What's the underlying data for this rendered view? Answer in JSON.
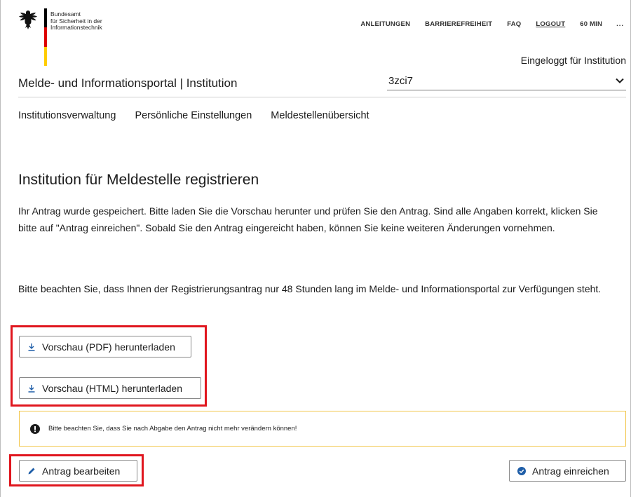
{
  "header": {
    "logo": {
      "line1": "Bundesamt",
      "line2": "für Sicherheit in der",
      "line3": "Informationstechnik",
      "icon": "federal-eagle-icon"
    },
    "topnav": {
      "instructions": "ANLEITUNGEN",
      "accessibility": "BARRIEREFREIHEIT",
      "faq": "FAQ",
      "logout": "LOGOUT",
      "timer": "60 MIN",
      "more": "..."
    },
    "logged_in_label": "Eingeloggt für Institution",
    "portal_title": "Melde- und Informationsportal | Institution",
    "institution_select": {
      "value": "3zci7",
      "icon": "chevron-down-icon"
    }
  },
  "mainnav": {
    "items": [
      {
        "label": "Institutionsverwaltung"
      },
      {
        "label": "Persönliche Einstellungen"
      },
      {
        "label": "Meldestellenübersicht"
      }
    ]
  },
  "main": {
    "title": "Institution für Meldestelle registrieren",
    "paragraph1": "Ihr Antrag wurde gespeichert. Bitte laden Sie die Vorschau herunter und prüfen Sie den Antrag. Sind alle Angaben korrekt, klicken Sie bitte auf \"Antrag einreichen\". Sobald Sie den Antrag eingereicht haben, können Sie keine weiteren Änderungen vornehmen.",
    "paragraph2": "Bitte beachten Sie, dass Ihnen der Registrierungsantrag nur 48 Stunden lang im Melde- und Informationsportal zur Verfügungen steht.",
    "buttons": {
      "pdf_label": "Vorschau (PDF) herunterladen",
      "html_label": "Vorschau (HTML) herunterladen",
      "edit_label": "Antrag bearbeiten",
      "submit_label": "Antrag einreichen"
    },
    "notice": {
      "text": "Bitte beachten Sie, dass Sie nach Abgabe den Antrag nicht mehr verändern können!",
      "icon": "exclamation-circle-icon"
    }
  },
  "colors": {
    "highlight": "#e0161e",
    "notice_border": "#f2c64a",
    "primary_blue": "#1f5ea8",
    "flag_black": "#000000",
    "flag_red": "#dd0000",
    "flag_gold": "#ffcc00"
  }
}
